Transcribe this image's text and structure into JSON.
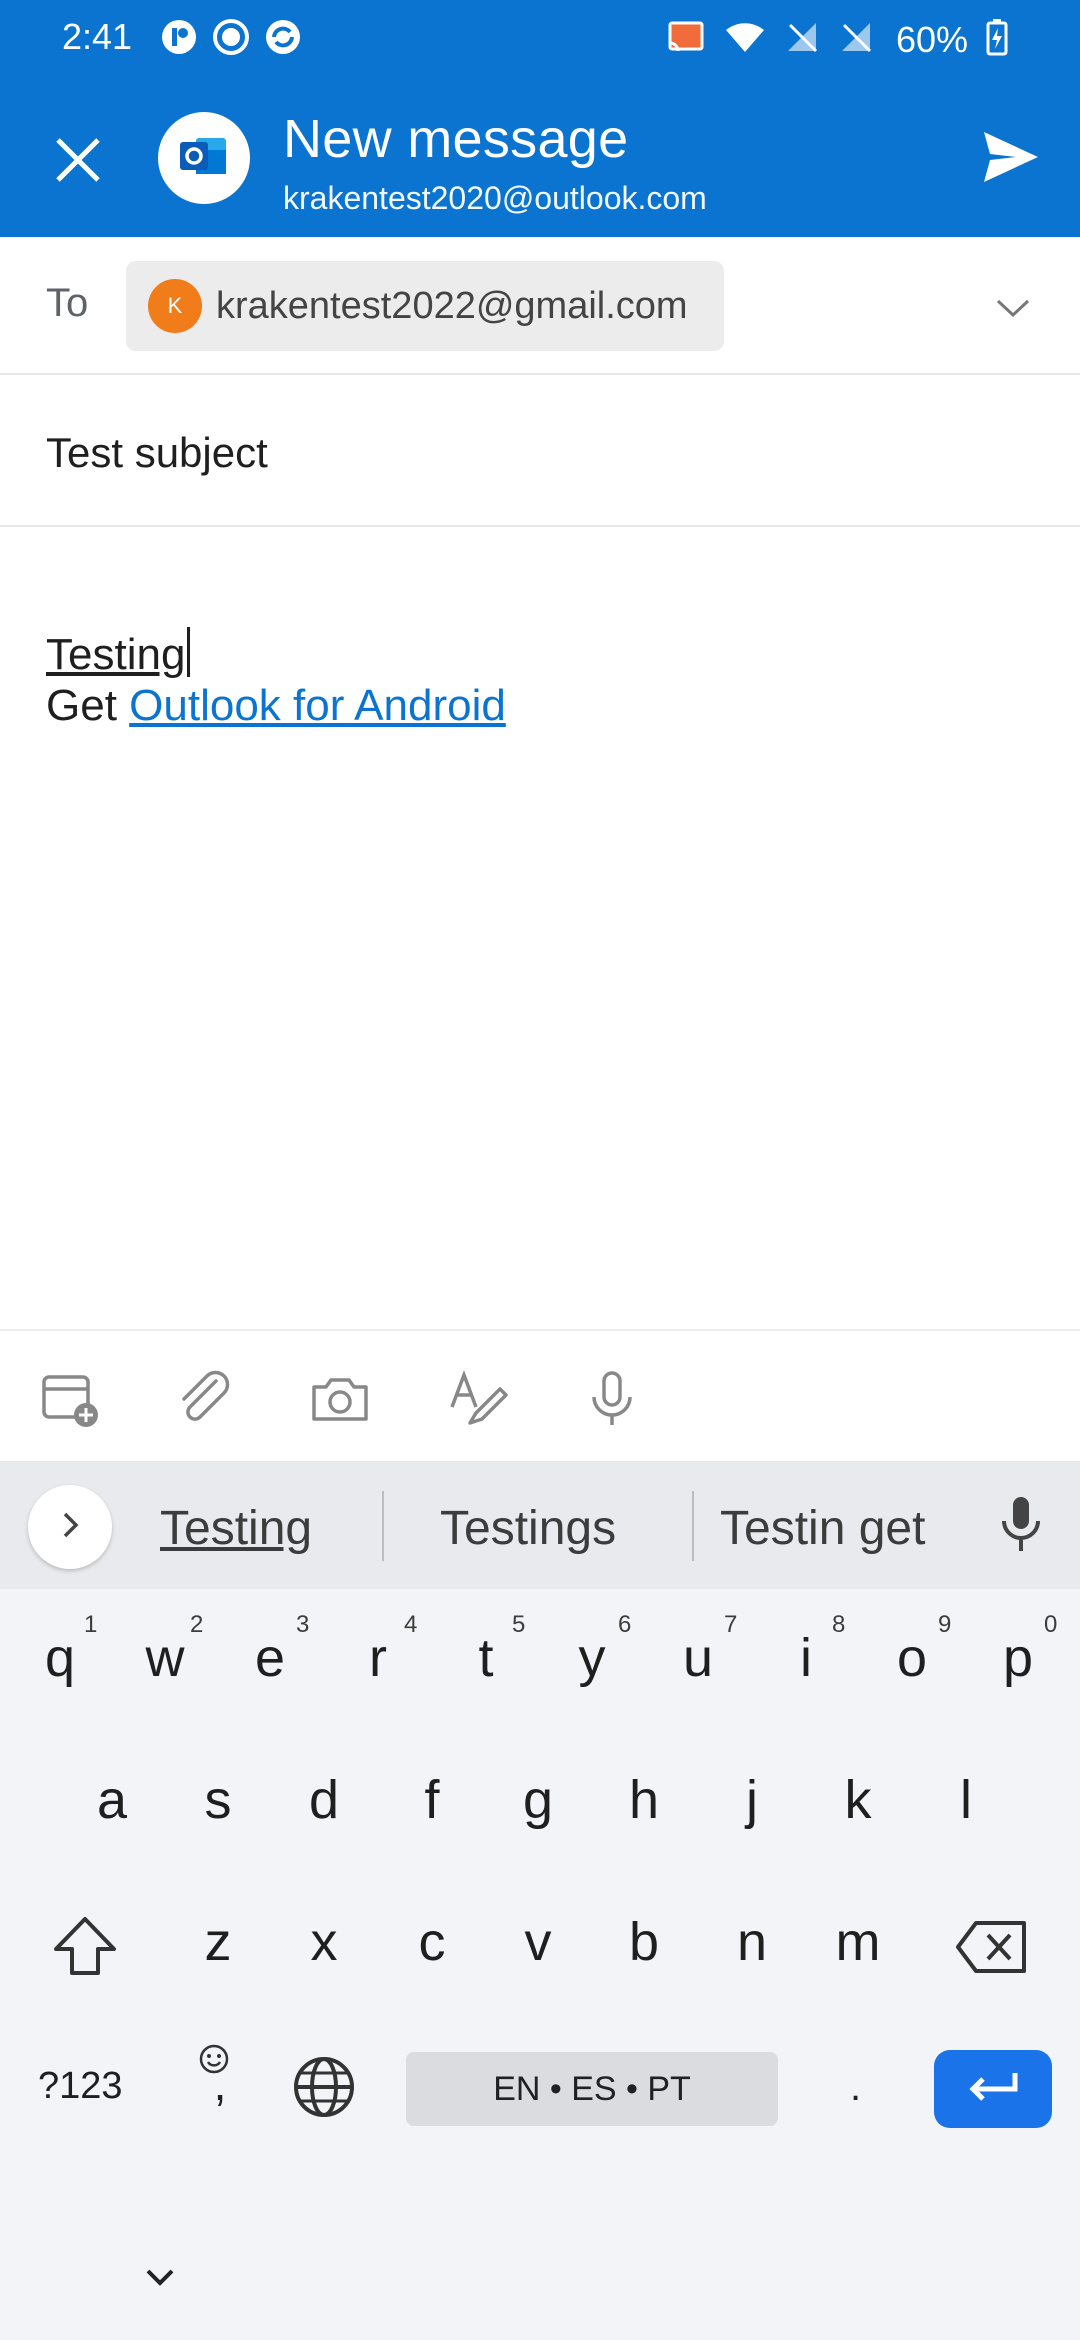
{
  "status_bar": {
    "time": "2:41",
    "battery": "60%",
    "left_icons": [
      "app-notification-icon",
      "record-icon",
      "sync-icon"
    ],
    "right_icons": [
      "cast-icon",
      "wifi-icon",
      "no-sim-icon",
      "no-sim-icon",
      "battery-charging-icon"
    ]
  },
  "app_bar": {
    "title": "New message",
    "account": "krakentest2020@outlook.com",
    "close_icon": "close-icon",
    "send_icon": "send-icon",
    "accent": "#0a74d0"
  },
  "compose": {
    "to_label": "To",
    "recipient_initial": "K",
    "recipient": "krakentest2022@gmail.com",
    "subject": "Test subject",
    "body_text": "Testing",
    "signature_prefix": "Get",
    "signature_link": "Outlook for Android"
  },
  "toolbar": {
    "icons": [
      "calendar-add-icon",
      "attach-icon",
      "camera-icon",
      "format-icon",
      "dictation-icon"
    ]
  },
  "keyboard": {
    "suggestions": [
      "Testing",
      "Testings",
      "Testin get"
    ],
    "row1": [
      "q",
      "w",
      "e",
      "r",
      "t",
      "y",
      "u",
      "i",
      "o",
      "p"
    ],
    "row1_hints": [
      "1",
      "2",
      "3",
      "4",
      "5",
      "6",
      "7",
      "8",
      "9",
      "0"
    ],
    "row2": [
      "a",
      "s",
      "d",
      "f",
      "g",
      "h",
      "j",
      "k",
      "l"
    ],
    "row3": [
      "z",
      "x",
      "c",
      "v",
      "b",
      "n",
      "m"
    ],
    "symbols_label": "?123",
    "comma": ",",
    "space_label": "EN • ES • PT",
    "period": ".",
    "enter_color": "#1a73e8"
  }
}
